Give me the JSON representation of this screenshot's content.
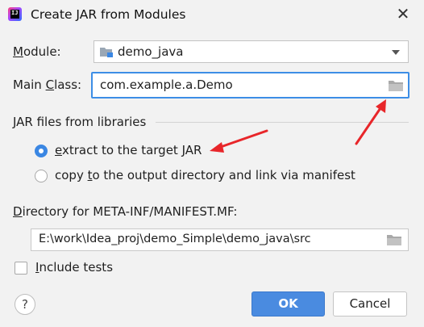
{
  "window": {
    "title": "Create JAR from Modules",
    "close_glyph": "✕",
    "app_icon_text": "IJ"
  },
  "module": {
    "label_underlined": "M",
    "label_rest": "odule:",
    "value": "demo_java"
  },
  "main_class": {
    "label_pre": "Main ",
    "label_underlined": "C",
    "label_post": "lass:",
    "value": "com.example.a.Demo"
  },
  "jar_section": {
    "title": "JAR files from libraries",
    "options": [
      {
        "pre": "",
        "underlined": "e",
        "post": "xtract to the target JAR",
        "selected": true
      },
      {
        "pre": "copy ",
        "underlined": "t",
        "post": "o the output directory and link via manifest",
        "selected": false
      }
    ]
  },
  "manifest": {
    "label_underlined": "D",
    "label_rest": "irectory for META-INF/MANIFEST.MF:",
    "value": "E:\\work\\Idea_proj\\demo_Simple\\demo_java\\src"
  },
  "include_tests": {
    "label_underlined": "I",
    "label_rest": "nclude tests",
    "checked": false
  },
  "buttons": {
    "help": "?",
    "ok": "OK",
    "cancel": "Cancel"
  },
  "colors": {
    "accent": "#3b87e3",
    "focus_border": "#3d8ee6",
    "annotation_arrow": "#e8262a",
    "dialog_bg": "#f2f2f2"
  }
}
